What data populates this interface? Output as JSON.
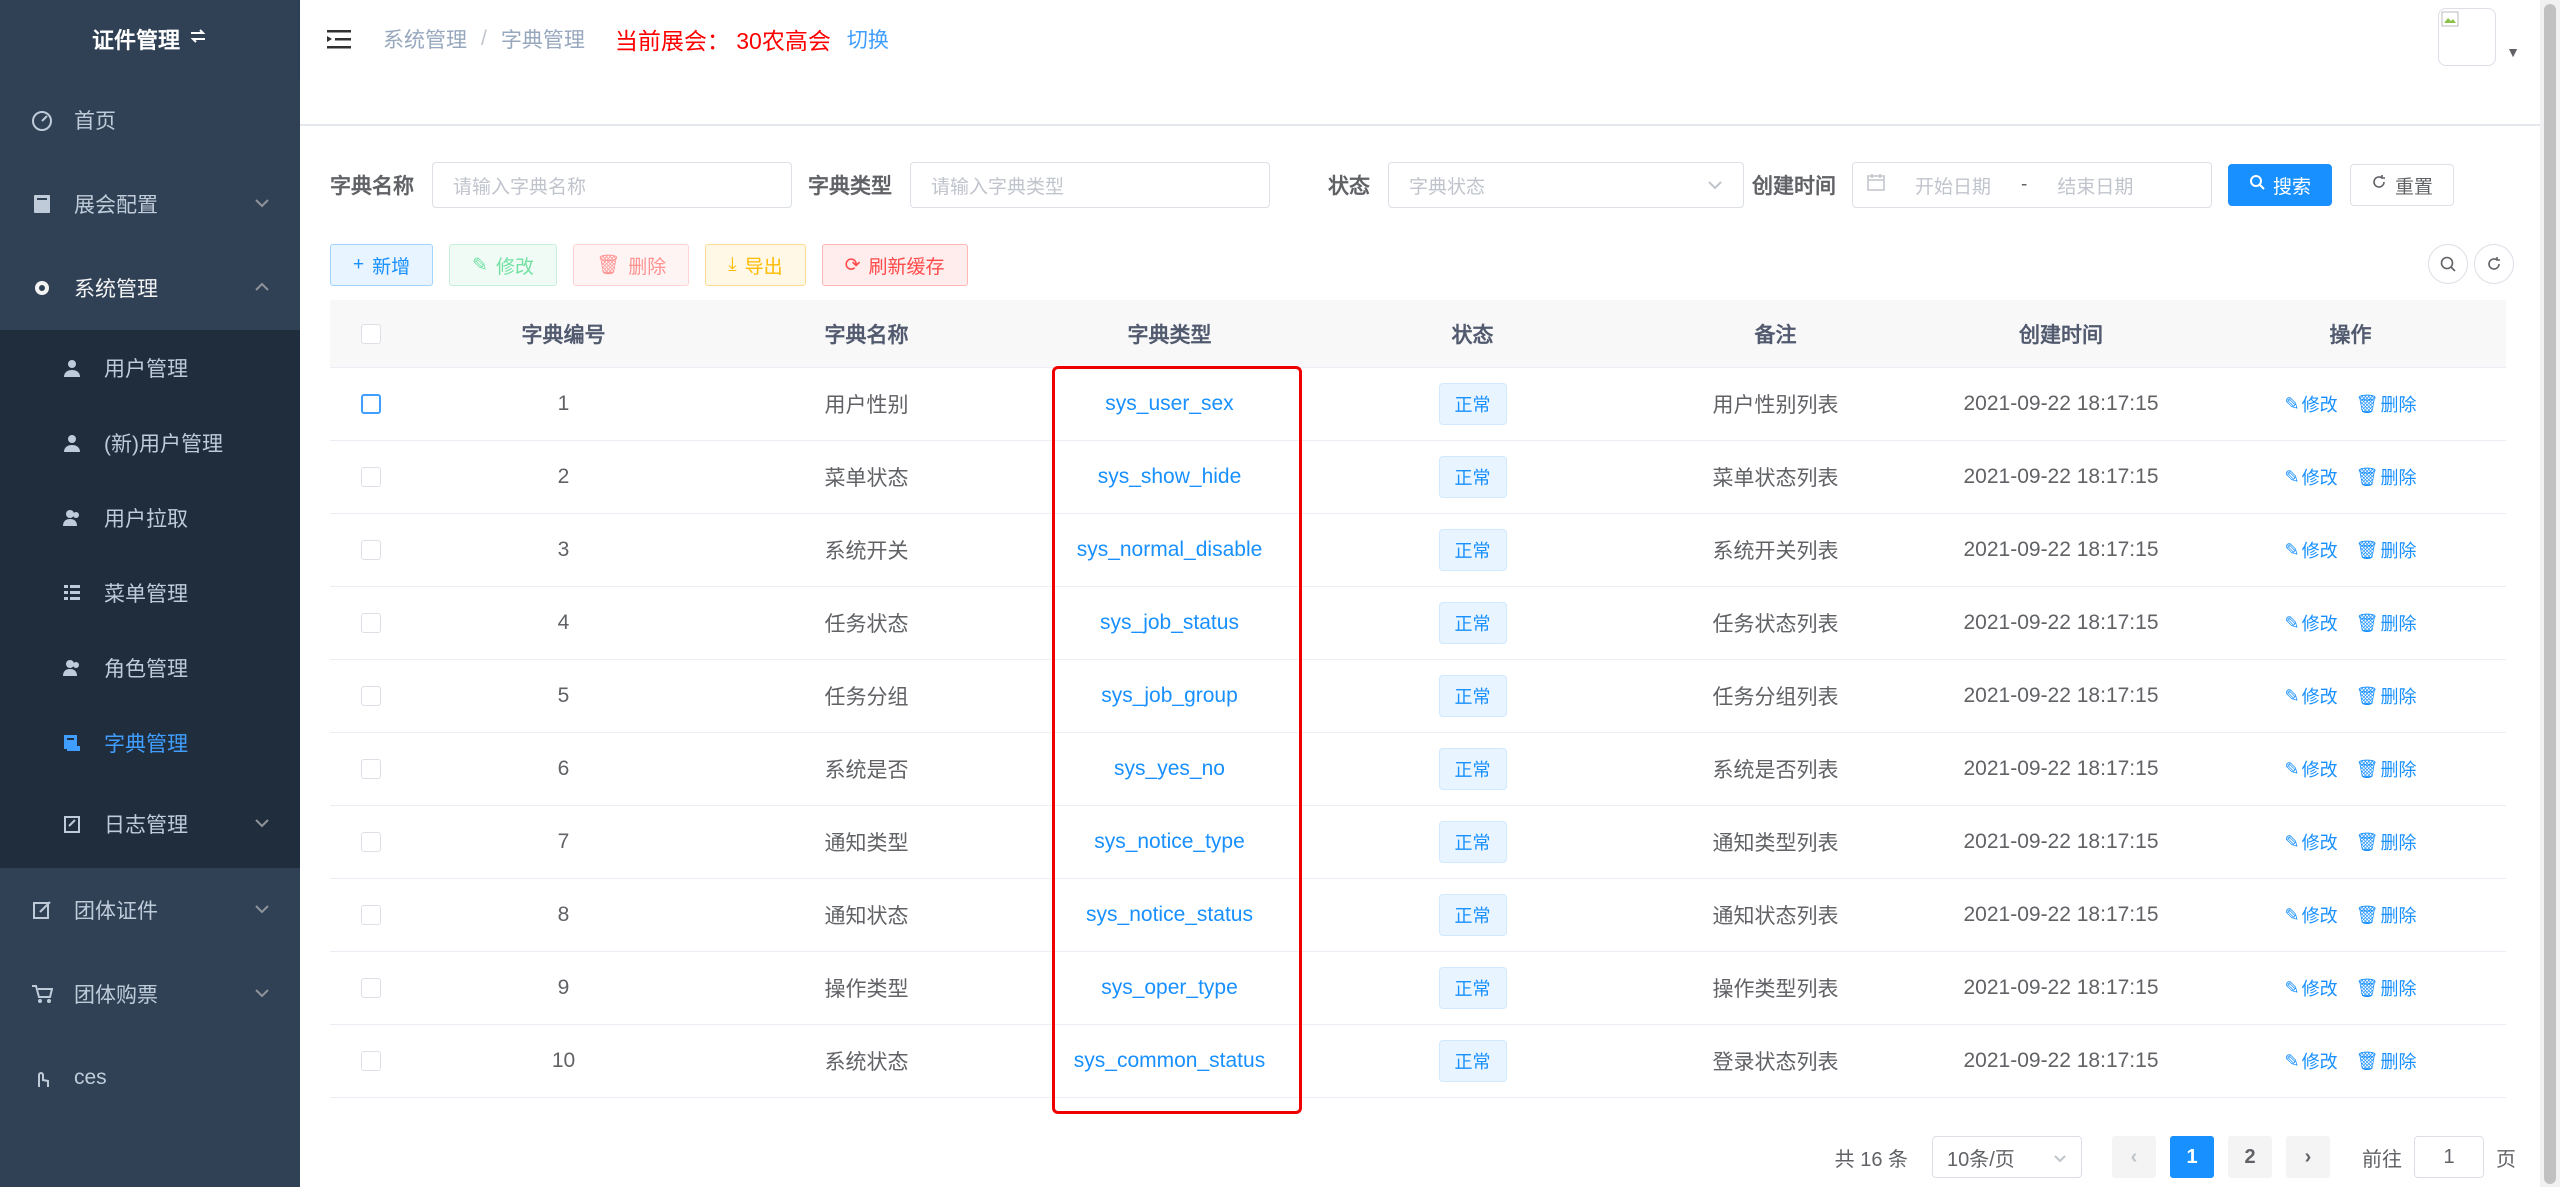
{
  "app": {
    "title": "证件管理"
  },
  "sidebar": {
    "items": [
      {
        "label": "首页",
        "icon": "dashboard-icon"
      },
      {
        "label": "展会配置",
        "icon": "expo-config-icon"
      },
      {
        "label": "系统管理",
        "icon": "gear-icon"
      },
      {
        "label": "团体证件",
        "icon": "edit-icon"
      },
      {
        "label": "团体购票",
        "icon": "cart-icon"
      },
      {
        "label": "ces",
        "icon": "hand-icon"
      }
    ],
    "submenu": [
      {
        "label": "用户管理",
        "icon": "user-icon"
      },
      {
        "label": "(新)用户管理",
        "icon": "user-icon"
      },
      {
        "label": "用户拉取",
        "icon": "peoples-icon"
      },
      {
        "label": "菜单管理",
        "icon": "tree-table-icon"
      },
      {
        "label": "角色管理",
        "icon": "peoples-icon"
      },
      {
        "label": "字典管理",
        "icon": "dict-icon"
      },
      {
        "label": "日志管理",
        "icon": "log-icon"
      }
    ]
  },
  "header": {
    "breadcrumb": [
      "系统管理",
      "/",
      "字典管理"
    ],
    "current_expo": "当前展会： 30农高会",
    "switch": "切换"
  },
  "search": {
    "name_label": "字典名称",
    "name_placeholder": "请输入字典名称",
    "type_label": "字典类型",
    "type_placeholder": "请输入字典类型",
    "status_label": "状态",
    "status_placeholder": "字典状态",
    "time_label": "创建时间",
    "start_placeholder": "开始日期",
    "range_sep": "-",
    "end_placeholder": "结束日期",
    "search_btn": "搜索",
    "reset_btn": "重置"
  },
  "toolbar": {
    "add": "新增",
    "edit": "修改",
    "delete": "删除",
    "export": "导出",
    "refresh": "刷新缓存"
  },
  "table": {
    "headers": [
      "字典编号",
      "字典名称",
      "字典类型",
      "状态",
      "备注",
      "创建时间",
      "操作"
    ],
    "status_label": "正常",
    "edit_label": "修改",
    "delete_label": "删除",
    "rows": [
      {
        "id": "1",
        "name": "用户性别",
        "type": "sys_user_sex",
        "remark": "用户性别列表",
        "created": "2021-09-22 18:17:15"
      },
      {
        "id": "2",
        "name": "菜单状态",
        "type": "sys_show_hide",
        "remark": "菜单状态列表",
        "created": "2021-09-22 18:17:15"
      },
      {
        "id": "3",
        "name": "系统开关",
        "type": "sys_normal_disable",
        "remark": "系统开关列表",
        "created": "2021-09-22 18:17:15"
      },
      {
        "id": "4",
        "name": "任务状态",
        "type": "sys_job_status",
        "remark": "任务状态列表",
        "created": "2021-09-22 18:17:15"
      },
      {
        "id": "5",
        "name": "任务分组",
        "type": "sys_job_group",
        "remark": "任务分组列表",
        "created": "2021-09-22 18:17:15"
      },
      {
        "id": "6",
        "name": "系统是否",
        "type": "sys_yes_no",
        "remark": "系统是否列表",
        "created": "2021-09-22 18:17:15"
      },
      {
        "id": "7",
        "name": "通知类型",
        "type": "sys_notice_type",
        "remark": "通知类型列表",
        "created": "2021-09-22 18:17:15"
      },
      {
        "id": "8",
        "name": "通知状态",
        "type": "sys_notice_status",
        "remark": "通知状态列表",
        "created": "2021-09-22 18:17:15"
      },
      {
        "id": "9",
        "name": "操作类型",
        "type": "sys_oper_type",
        "remark": "操作类型列表",
        "created": "2021-09-22 18:17:15"
      },
      {
        "id": "10",
        "name": "系统状态",
        "type": "sys_common_status",
        "remark": "登录状态列表",
        "created": "2021-09-22 18:17:15"
      }
    ]
  },
  "pagination": {
    "total": "共 16 条",
    "page_size": "10条/页",
    "prev": "‹",
    "pages": [
      "1",
      "2"
    ],
    "next": "›",
    "goto_prefix": "前往",
    "goto_value": "1",
    "goto_suffix": "页"
  },
  "colors": {
    "sidebar_bg": "#304156",
    "accent": "#1890ff",
    "highlight": "#e00000"
  }
}
